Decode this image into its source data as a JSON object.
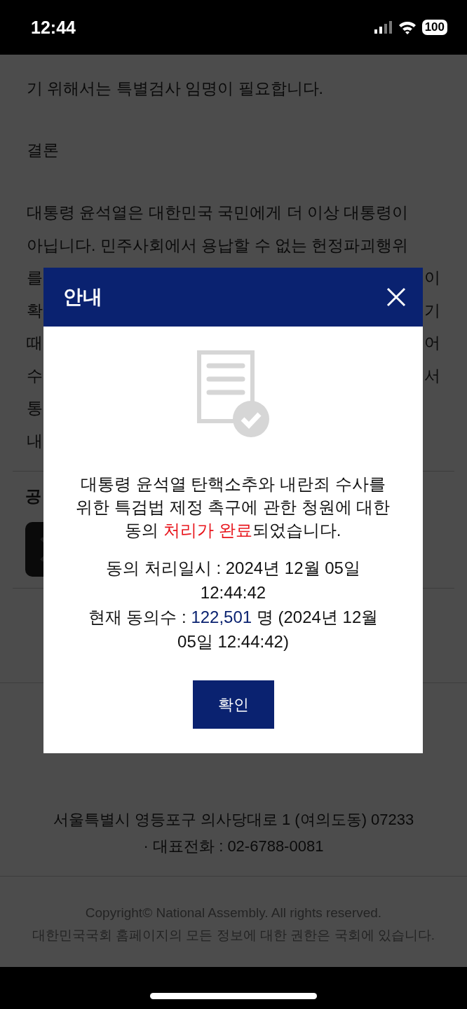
{
  "status_bar": {
    "time": "12:44",
    "battery": "100"
  },
  "article": {
    "intro_lines": [
      "기 위해서는 특별검사 임명이 필요합니다."
    ],
    "heading": "결론",
    "paragraph_lines": [
      {
        "left": "대통령 윤석열은 대한민국 국민에게 더 이상 대통령이"
      },
      {
        "left": "아닙니다. 민주사회에서 용납할 수 없는 헌정파괴행위"
      },
      {
        "left": "를",
        "right": "이"
      },
      {
        "left": "확",
        "right": "기"
      },
      {
        "left": "때",
        "right": "어"
      },
      {
        "left": "수",
        "right": "서"
      },
      {
        "left": "통"
      },
      {
        "left": "내"
      }
    ]
  },
  "section_heading": "공",
  "footer": {
    "address": "서울특별시 영등포구 의사당대로 1 (여의도동) 07233",
    "phone": "· 대표전화 : 02-6788-0081",
    "copyright": [
      "Copyright© National Assembly. All rights reserved.",
      "대한민국국회 홈페이지의 모든 정보에 대한 권한은 국회에 있습니다."
    ]
  },
  "modal": {
    "title": "안내",
    "message": {
      "before": "대통령 윤석열 탄핵소추와 내란죄 수사를 위한 특검법 제정 촉구에 관한 청원에 대한 동의 ",
      "highlight": "처리가 완료",
      "after": "되었습니다."
    },
    "date_line": "동의 처리일시 : 2024년 12월 05일 12:44:42",
    "count_line": {
      "label": "현재 동의수 : ",
      "count": "122,501",
      "rest": " 명 (2024년 12월 05일 12:44:42)"
    },
    "confirm": "확인"
  }
}
